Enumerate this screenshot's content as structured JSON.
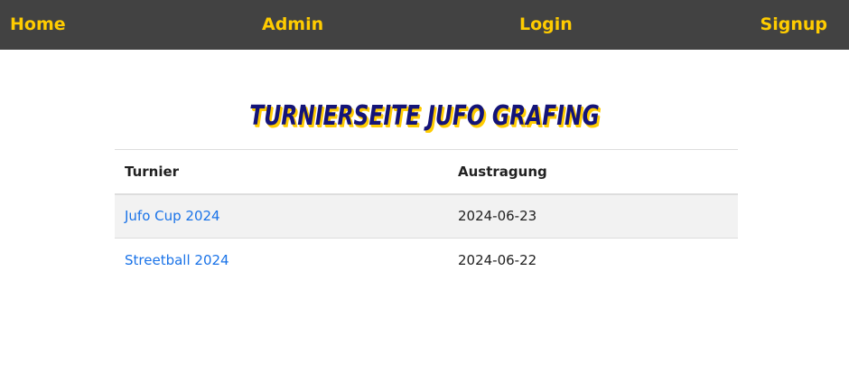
{
  "nav": {
    "home": "Home",
    "admin": "Admin",
    "login": "Login",
    "signup": "Signup"
  },
  "colors": {
    "navbar_bg": "#424242",
    "nav_link": "#ffcc00",
    "title": "#141478",
    "title_shadow": "#ffcc00",
    "link": "#1a73e8"
  },
  "title": "Turnierseite Jufo Grafing",
  "table": {
    "headers": [
      "Turnier",
      "Austragung"
    ],
    "rows": [
      {
        "name": "Jufo Cup 2024",
        "date": "2024-06-23"
      },
      {
        "name": "Streetball 2024",
        "date": "2024-06-22"
      }
    ]
  }
}
